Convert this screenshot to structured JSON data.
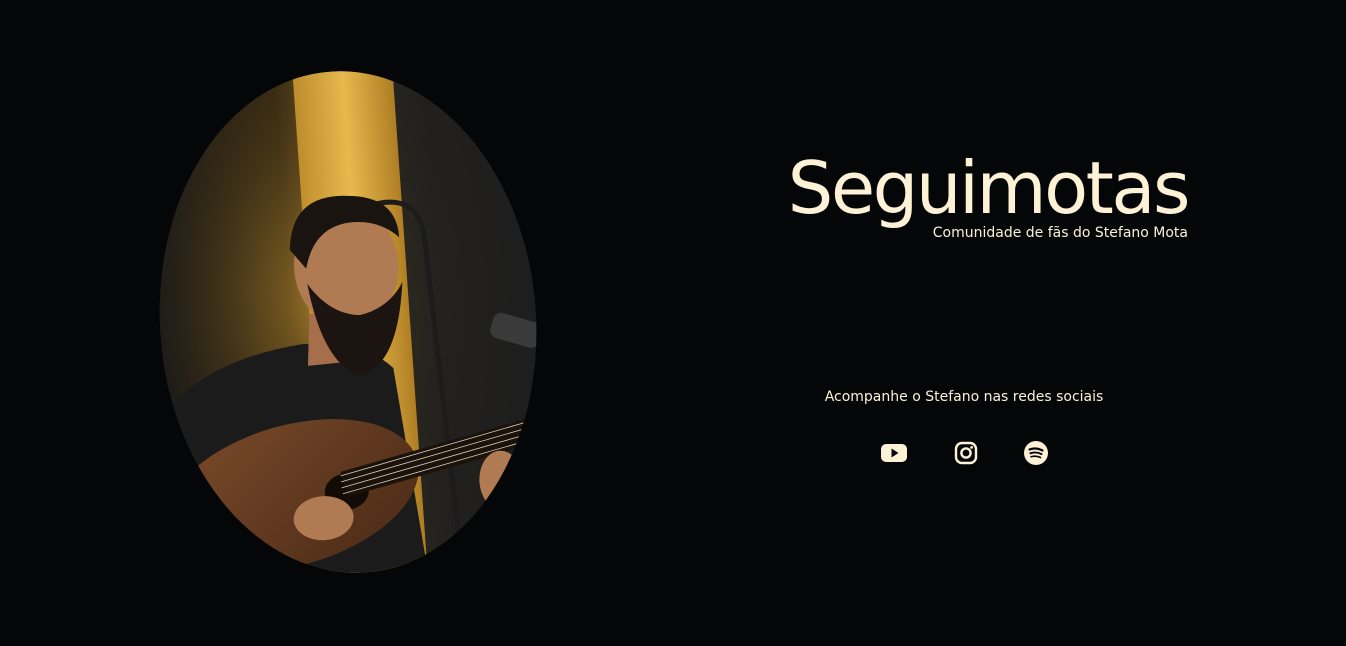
{
  "hero": {
    "title": "Seguimotas",
    "subtitle": "Comunidade de fãs do Stefano Mota",
    "portrait": {
      "description_icon": "portrait-photo",
      "alt": ""
    }
  },
  "social": {
    "heading": "Acompanhe o Stefano nas redes sociais",
    "links": [
      {
        "icon": "youtube-icon"
      },
      {
        "icon": "instagram-icon"
      },
      {
        "icon": "spotify-icon"
      }
    ]
  },
  "colors": {
    "background": "#040608",
    "text": "#fdf1d6",
    "accent_light": "#f0b43a"
  }
}
